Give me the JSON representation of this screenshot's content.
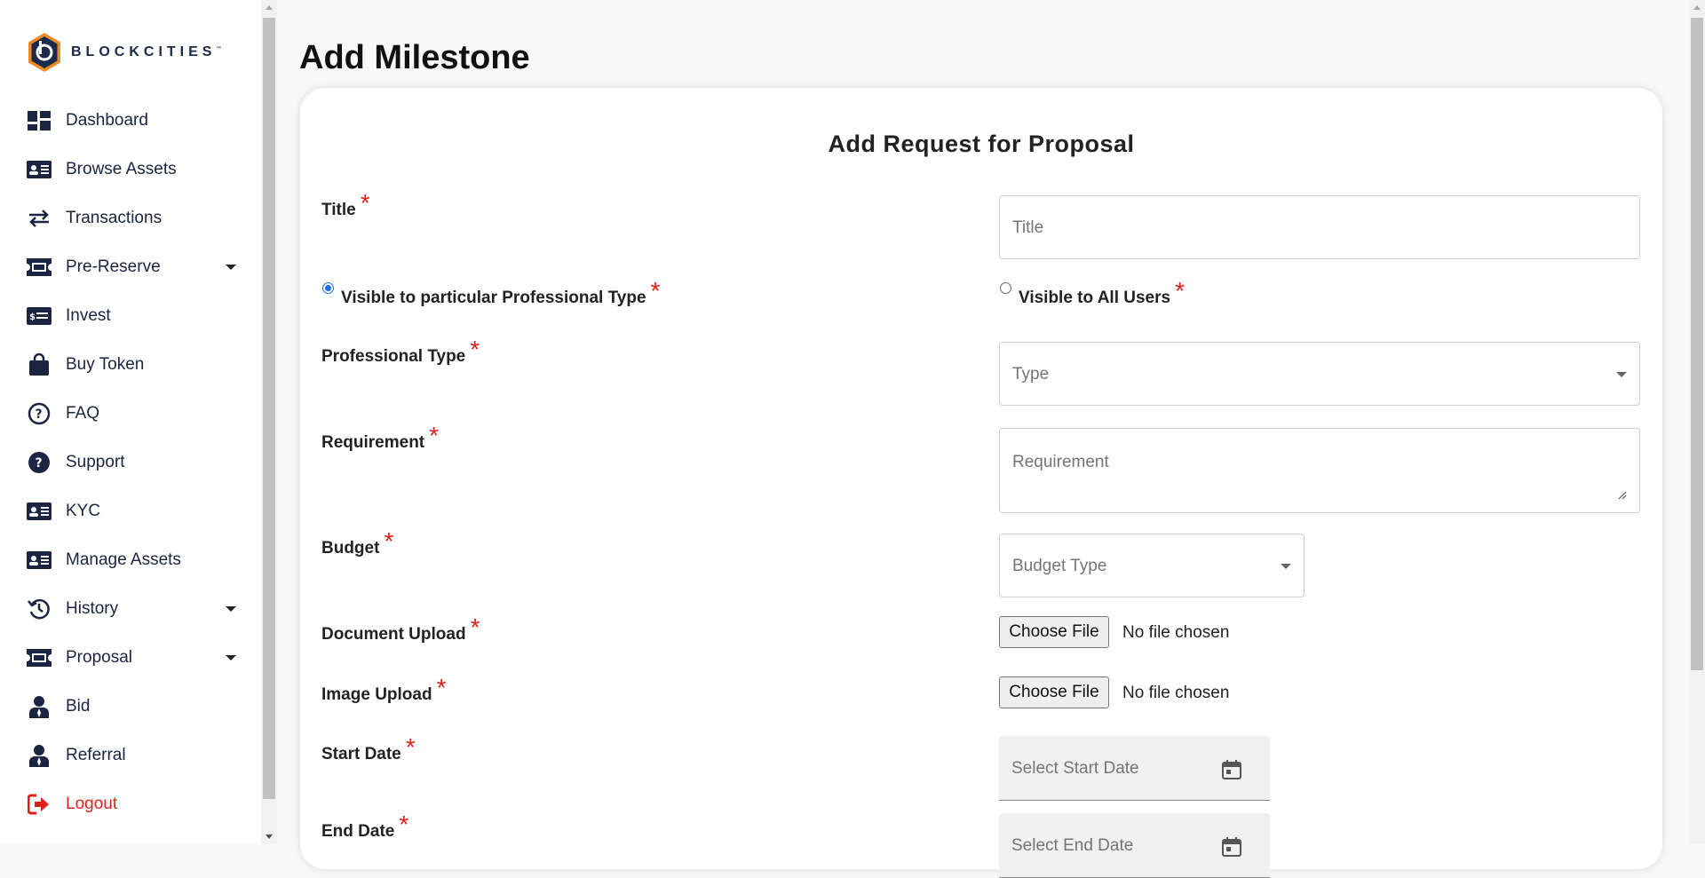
{
  "brand": {
    "name": "BLOCKCITIES",
    "tm": "™"
  },
  "sidebar": {
    "items": [
      {
        "label": "Dashboard",
        "icon": "dashboard-icon"
      },
      {
        "label": "Browse Assets",
        "icon": "id-card-icon"
      },
      {
        "label": "Transactions",
        "icon": "swap-arrows-icon"
      },
      {
        "label": "Pre-Reserve",
        "icon": "ticket-icon",
        "has_dropdown": true
      },
      {
        "label": "Invest",
        "icon": "money-card-icon"
      },
      {
        "label": "Buy Token",
        "icon": "shopping-bag-icon"
      },
      {
        "label": "FAQ",
        "icon": "question-circle-outline-icon"
      },
      {
        "label": "Support",
        "icon": "question-circle-filled-icon"
      },
      {
        "label": "KYC",
        "icon": "id-card-icon"
      },
      {
        "label": "Manage Assets",
        "icon": "id-card-icon"
      },
      {
        "label": "History",
        "icon": "history-icon",
        "has_dropdown": true
      },
      {
        "label": "Proposal",
        "icon": "ticket-icon",
        "has_dropdown": true
      },
      {
        "label": "Bid",
        "icon": "user-tie-icon"
      },
      {
        "label": "Referral",
        "icon": "user-tie-icon"
      },
      {
        "label": "Logout",
        "icon": "logout-icon"
      }
    ]
  },
  "page": {
    "title": "Add Milestone"
  },
  "form": {
    "title": "Add Request for Proposal",
    "required_mark": "*",
    "fields": {
      "title": {
        "label": "Title",
        "placeholder": "Title"
      },
      "visibility": {
        "option_particular": "Visible to particular Professional Type",
        "option_all": "Visible to All Users",
        "selected": "particular"
      },
      "professional_type": {
        "label": "Professional Type",
        "placeholder": "Type"
      },
      "requirement": {
        "label": "Requirement",
        "placeholder": "Requirement"
      },
      "budget": {
        "label": "Budget",
        "placeholder": "Budget Type"
      },
      "document_upload": {
        "label": "Document Upload",
        "button": "Choose File",
        "status": "No file chosen"
      },
      "image_upload": {
        "label": "Image Upload",
        "button": "Choose File",
        "status": "No file chosen"
      },
      "start_date": {
        "label": "Start Date",
        "placeholder": "Select Start Date"
      },
      "end_date": {
        "label": "End Date",
        "placeholder": "Select End Date"
      }
    }
  },
  "colors": {
    "accent": "#1a73e8",
    "required": "#e0201b",
    "logout": "#e0201b",
    "brand_orange": "#f08a24",
    "brand_navy": "#1b2a4a"
  }
}
